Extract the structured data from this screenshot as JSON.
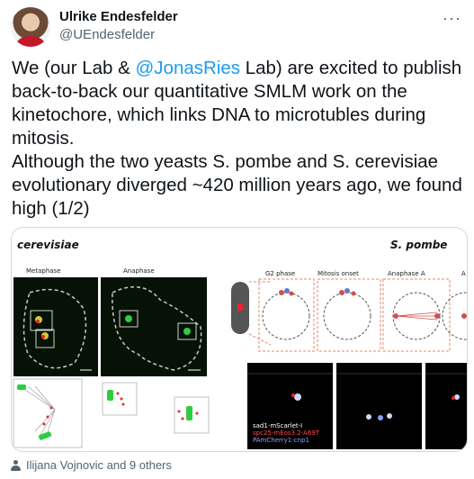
{
  "author": {
    "display_name": "Ulrike Endesfelder",
    "handle": "@UEndesfelder"
  },
  "tweet": {
    "text_before": "We (our Lab & ",
    "mention": "@JonasRies",
    "text_after": " Lab) are excited to publish back-to-back our quantitative SMLM work on the kinetochore, which links DNA to microtubles during mitosis.",
    "line2": "Although the two yeasts S. pombe and S. cerevisiae evolutionary diverged ~420 million years ago, we found high (1/2)"
  },
  "media": {
    "left_title": "cerevisiae",
    "right_title": "S. pombe",
    "panels": {
      "metaphase": "Metaphase",
      "anaphase": "Anaphase",
      "g2": "G2 phase",
      "mitosis_onset": "Mitosis onset",
      "anaphase_a": "Anaphase A",
      "a_clip": "A"
    },
    "legend": {
      "line1": "sad1-mScarlet-I",
      "line2": "spc25-mEos3.2-A69T",
      "line3": "PAmCherry1-cnp1"
    },
    "colors": {
      "green": "#2ecc40",
      "red": "#e8252e",
      "dashed": "#c8c8c8",
      "salmon": "#e8846c"
    }
  },
  "tagline": {
    "icon": "user-icon",
    "text": "Ilijana Vojnovic and 9 others"
  },
  "more_icon": "more-icon"
}
